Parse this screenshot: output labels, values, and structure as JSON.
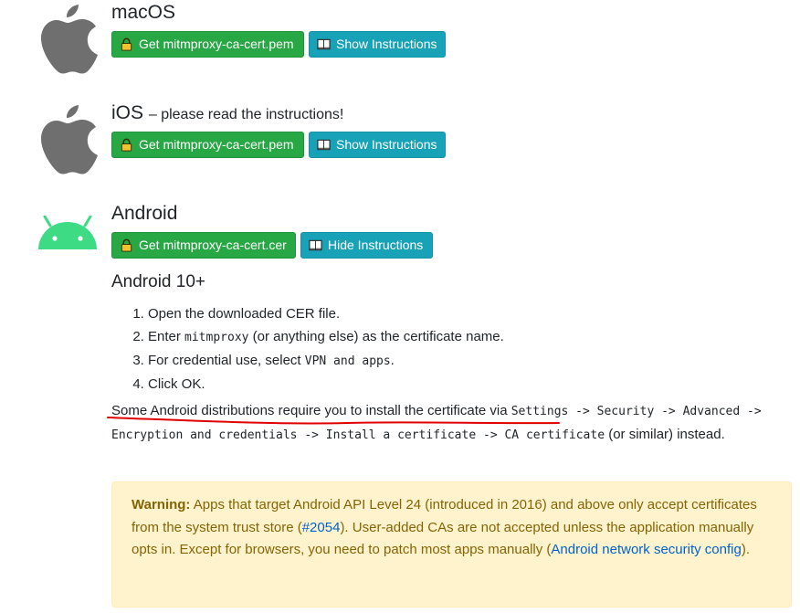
{
  "platforms": [
    {
      "name": "macOS",
      "note": "",
      "download_label": "Get mitmproxy-ca-cert.pem",
      "instructions_label": "Show Instructions"
    },
    {
      "name": "iOS",
      "note": "– please read the instructions!",
      "download_label": "Get mitmproxy-ca-cert.pem",
      "instructions_label": "Show Instructions"
    },
    {
      "name": "Android",
      "note": "",
      "download_label": "Get mitmproxy-ca-cert.cer",
      "instructions_label": "Hide Instructions"
    }
  ],
  "android_instructions": {
    "heading": "Android 10+",
    "steps": [
      {
        "pre": "Open the downloaded CER file.",
        "code": "",
        "post": ""
      },
      {
        "pre": "Enter ",
        "code": "mitmproxy",
        "post": " (or anything else) as the certificate name."
      },
      {
        "pre": "For credential use, select ",
        "code": "VPN and apps",
        "post": "."
      },
      {
        "pre": "Click OK.",
        "code": "",
        "post": ""
      }
    ],
    "note_pre": "Some Android distributions require you to install the certificate via ",
    "note_code": "Settings -> Security -> Advanced -> Encryption and credentials -> Install a certificate -> CA certificate",
    "note_post": " (or similar) instead.",
    "annotation_color": "#e00000"
  },
  "warning": {
    "label": "Warning:",
    "text1": " Apps that target Android API Level 24 (introduced in 2016) and above only accept certificates from the system trust store (",
    "issue_link": "#2054",
    "text2": "). User-added CAs are not accepted unless the application manually opts in. Except for browsers, you need to patch most apps manually (",
    "config_link": "Android network security config",
    "text3": ")."
  },
  "colors": {
    "green": "#28a745",
    "teal": "#17a2b8",
    "apple_gray": "#6f6f6f",
    "android_green": "#3ddc84",
    "warning_bg": "#fff3cd",
    "warning_text": "#856404",
    "link": "#0062cc"
  }
}
